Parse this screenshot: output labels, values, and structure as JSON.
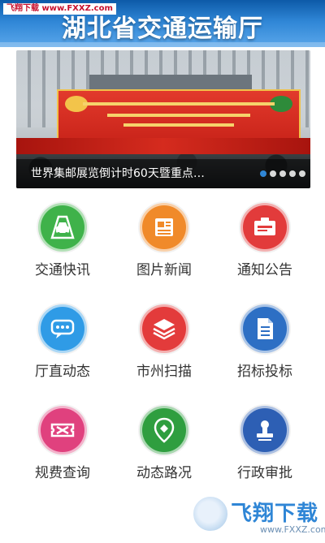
{
  "source_tag": "飞翔下载 www.FXXZ.com",
  "header": {
    "title": "湖北省交通运输厅"
  },
  "banner": {
    "caption": "世界集邮展览倒计时60天暨重点…",
    "slide_count": 5,
    "active_slide": 1
  },
  "menu": [
    {
      "label": "交通快讯",
      "icon": "car-road-icon",
      "color": "#3fb24a"
    },
    {
      "label": "图片新闻",
      "icon": "newspaper-icon",
      "color": "#f08a2a"
    },
    {
      "label": "通知公告",
      "icon": "notice-icon",
      "color": "#e23b3b"
    },
    {
      "label": "厅直动态",
      "icon": "chat-bubble-icon",
      "color": "#2f9be6"
    },
    {
      "label": "市州扫描",
      "icon": "layers-icon",
      "color": "#e33b3b"
    },
    {
      "label": "招标投标",
      "icon": "document-icon",
      "color": "#2d6fc4"
    },
    {
      "label": "规费查询",
      "icon": "ticket-icon",
      "color": "#e0417e"
    },
    {
      "label": "动态路况",
      "icon": "map-pin-icon",
      "color": "#2f9e3f"
    },
    {
      "label": "行政审批",
      "icon": "stamp-icon",
      "color": "#2d5fb4"
    }
  ],
  "watermark": {
    "text": "飞翔下载",
    "url": "www.FXXZ.com"
  }
}
